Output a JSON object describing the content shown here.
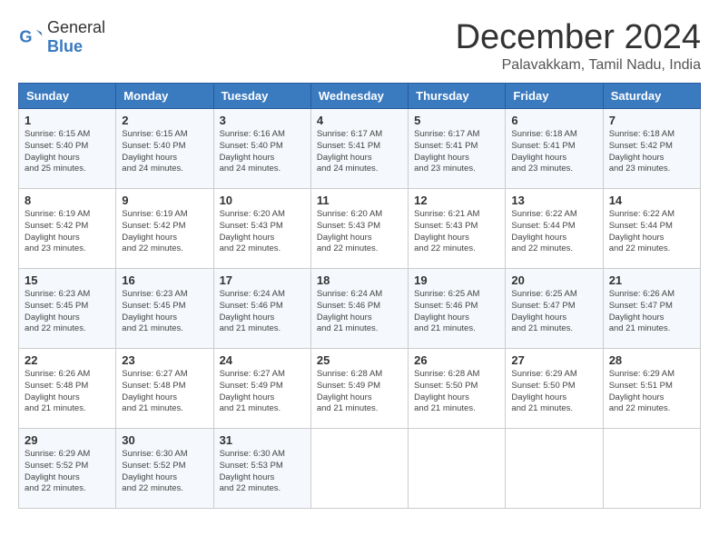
{
  "header": {
    "logo_general": "General",
    "logo_blue": "Blue",
    "month_title": "December 2024",
    "location": "Palavakkam, Tamil Nadu, India"
  },
  "weekdays": [
    "Sunday",
    "Monday",
    "Tuesday",
    "Wednesday",
    "Thursday",
    "Friday",
    "Saturday"
  ],
  "weeks": [
    [
      {
        "day": "1",
        "sunrise": "6:15 AM",
        "sunset": "5:40 PM",
        "daylight": "11 hours and 25 minutes."
      },
      {
        "day": "2",
        "sunrise": "6:15 AM",
        "sunset": "5:40 PM",
        "daylight": "11 hours and 24 minutes."
      },
      {
        "day": "3",
        "sunrise": "6:16 AM",
        "sunset": "5:40 PM",
        "daylight": "11 hours and 24 minutes."
      },
      {
        "day": "4",
        "sunrise": "6:17 AM",
        "sunset": "5:41 PM",
        "daylight": "11 hours and 24 minutes."
      },
      {
        "day": "5",
        "sunrise": "6:17 AM",
        "sunset": "5:41 PM",
        "daylight": "11 hours and 23 minutes."
      },
      {
        "day": "6",
        "sunrise": "6:18 AM",
        "sunset": "5:41 PM",
        "daylight": "11 hours and 23 minutes."
      },
      {
        "day": "7",
        "sunrise": "6:18 AM",
        "sunset": "5:42 PM",
        "daylight": "11 hours and 23 minutes."
      }
    ],
    [
      {
        "day": "8",
        "sunrise": "6:19 AM",
        "sunset": "5:42 PM",
        "daylight": "11 hours and 23 minutes."
      },
      {
        "day": "9",
        "sunrise": "6:19 AM",
        "sunset": "5:42 PM",
        "daylight": "11 hours and 22 minutes."
      },
      {
        "day": "10",
        "sunrise": "6:20 AM",
        "sunset": "5:43 PM",
        "daylight": "11 hours and 22 minutes."
      },
      {
        "day": "11",
        "sunrise": "6:20 AM",
        "sunset": "5:43 PM",
        "daylight": "11 hours and 22 minutes."
      },
      {
        "day": "12",
        "sunrise": "6:21 AM",
        "sunset": "5:43 PM",
        "daylight": "11 hours and 22 minutes."
      },
      {
        "day": "13",
        "sunrise": "6:22 AM",
        "sunset": "5:44 PM",
        "daylight": "11 hours and 22 minutes."
      },
      {
        "day": "14",
        "sunrise": "6:22 AM",
        "sunset": "5:44 PM",
        "daylight": "11 hours and 22 minutes."
      }
    ],
    [
      {
        "day": "15",
        "sunrise": "6:23 AM",
        "sunset": "5:45 PM",
        "daylight": "11 hours and 22 minutes."
      },
      {
        "day": "16",
        "sunrise": "6:23 AM",
        "sunset": "5:45 PM",
        "daylight": "11 hours and 21 minutes."
      },
      {
        "day": "17",
        "sunrise": "6:24 AM",
        "sunset": "5:46 PM",
        "daylight": "11 hours and 21 minutes."
      },
      {
        "day": "18",
        "sunrise": "6:24 AM",
        "sunset": "5:46 PM",
        "daylight": "11 hours and 21 minutes."
      },
      {
        "day": "19",
        "sunrise": "6:25 AM",
        "sunset": "5:46 PM",
        "daylight": "11 hours and 21 minutes."
      },
      {
        "day": "20",
        "sunrise": "6:25 AM",
        "sunset": "5:47 PM",
        "daylight": "11 hours and 21 minutes."
      },
      {
        "day": "21",
        "sunrise": "6:26 AM",
        "sunset": "5:47 PM",
        "daylight": "11 hours and 21 minutes."
      }
    ],
    [
      {
        "day": "22",
        "sunrise": "6:26 AM",
        "sunset": "5:48 PM",
        "daylight": "11 hours and 21 minutes."
      },
      {
        "day": "23",
        "sunrise": "6:27 AM",
        "sunset": "5:48 PM",
        "daylight": "11 hours and 21 minutes."
      },
      {
        "day": "24",
        "sunrise": "6:27 AM",
        "sunset": "5:49 PM",
        "daylight": "11 hours and 21 minutes."
      },
      {
        "day": "25",
        "sunrise": "6:28 AM",
        "sunset": "5:49 PM",
        "daylight": "11 hours and 21 minutes."
      },
      {
        "day": "26",
        "sunrise": "6:28 AM",
        "sunset": "5:50 PM",
        "daylight": "11 hours and 21 minutes."
      },
      {
        "day": "27",
        "sunrise": "6:29 AM",
        "sunset": "5:50 PM",
        "daylight": "11 hours and 21 minutes."
      },
      {
        "day": "28",
        "sunrise": "6:29 AM",
        "sunset": "5:51 PM",
        "daylight": "11 hours and 22 minutes."
      }
    ],
    [
      {
        "day": "29",
        "sunrise": "6:29 AM",
        "sunset": "5:52 PM",
        "daylight": "11 hours and 22 minutes."
      },
      {
        "day": "30",
        "sunrise": "6:30 AM",
        "sunset": "5:52 PM",
        "daylight": "11 hours and 22 minutes."
      },
      {
        "day": "31",
        "sunrise": "6:30 AM",
        "sunset": "5:53 PM",
        "daylight": "11 hours and 22 minutes."
      },
      null,
      null,
      null,
      null
    ]
  ]
}
